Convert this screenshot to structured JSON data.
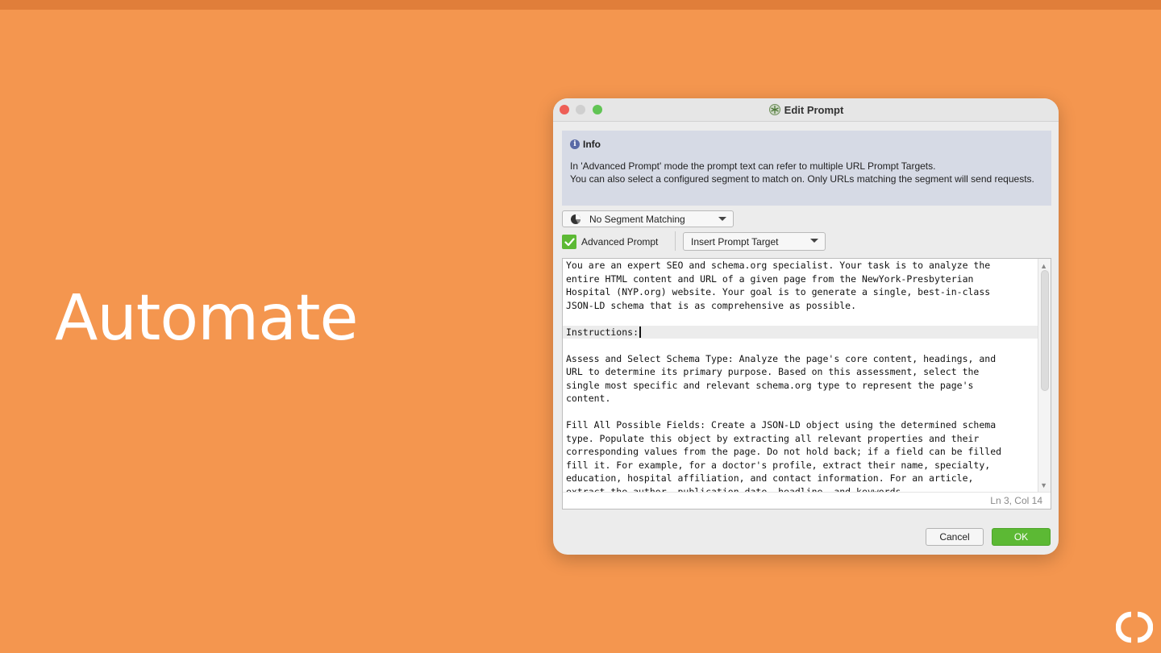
{
  "slide": {
    "headline": "Automate"
  },
  "window": {
    "title": "Edit Prompt"
  },
  "info": {
    "title": "Info",
    "line1": "In 'Advanced Prompt' mode the prompt text can refer to multiple URL Prompt Targets.",
    "line2": "You can also select a configured segment to match on. Only URLs matching the segment will send requests."
  },
  "controls": {
    "segment_dropdown": "No Segment Matching",
    "advanced_prompt_label": "Advanced Prompt",
    "advanced_prompt_checked": true,
    "insert_target_dropdown": "Insert Prompt Target"
  },
  "editor": {
    "lines": [
      "You are an expert SEO and schema.org specialist. Your task is to analyze the",
      "entire HTML content and URL of a given page from the NewYork-Presbyterian",
      "Hospital (NYP.org) website. Your goal is to generate a single, best-in-class",
      "JSON-LD schema that is as comprehensive as possible.",
      "",
      "Instructions:",
      "",
      "Assess and Select Schema Type: Analyze the page's core content, headings, and",
      "URL to determine its primary purpose. Based on this assessment, select the",
      "single most specific and relevant schema.org type to represent the page's",
      "content.",
      "",
      "Fill All Possible Fields: Create a JSON-LD object using the determined schema",
      "type. Populate this object by extracting all relevant properties and their",
      "corresponding values from the page. Do not hold back; if a field can be filled",
      "fill it. For example, for a doctor's profile, extract their name, specialty,",
      "education, hospital affiliation, and contact information. For an article,",
      "extract the author, publication date, headline, and keywords."
    ],
    "status": "Ln 3, Col 14"
  },
  "buttons": {
    "cancel": "Cancel",
    "ok": "OK"
  },
  "colors": {
    "background": "#f4964f",
    "accent_green": "#5cb934",
    "info_panel": "#d6dae5"
  }
}
